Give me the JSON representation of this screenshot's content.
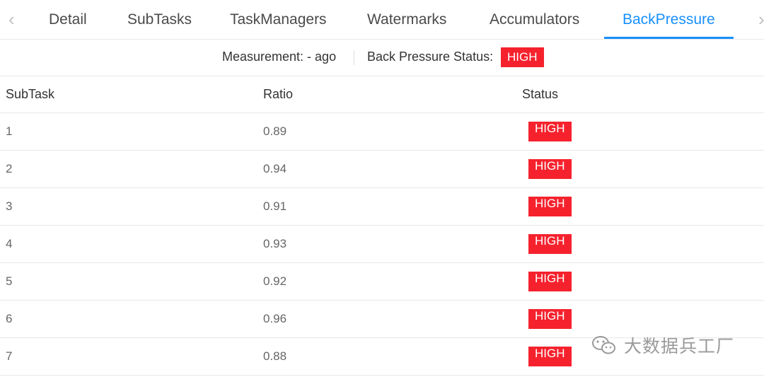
{
  "tabs": {
    "prev_arrow": "‹",
    "next_arrow": "›",
    "items": [
      {
        "label": "Detail"
      },
      {
        "label": "SubTasks"
      },
      {
        "label": "TaskManagers"
      },
      {
        "label": "Watermarks"
      },
      {
        "label": "Accumulators"
      },
      {
        "label": "BackPressure",
        "active": true
      }
    ]
  },
  "summary": {
    "measurement": "Measurement: - ago",
    "status_label": "Back Pressure Status:",
    "status": "HIGH"
  },
  "table": {
    "headers": {
      "subtask": "SubTask",
      "ratio": "Ratio",
      "status": "Status"
    },
    "rows": [
      {
        "subtask": "1",
        "ratio": "0.89",
        "status": "HIGH"
      },
      {
        "subtask": "2",
        "ratio": "0.94",
        "status": "HIGH"
      },
      {
        "subtask": "3",
        "ratio": "0.91",
        "status": "HIGH"
      },
      {
        "subtask": "4",
        "ratio": "0.93",
        "status": "HIGH"
      },
      {
        "subtask": "5",
        "ratio": "0.92",
        "status": "HIGH"
      },
      {
        "subtask": "6",
        "ratio": "0.96",
        "status": "HIGH"
      },
      {
        "subtask": "7",
        "ratio": "0.88",
        "status": "HIGH"
      }
    ]
  },
  "watermark": {
    "text": "大数据兵工厂",
    "icon": "wechat-icon"
  },
  "colors": {
    "accent": "#1890ff",
    "high": "#f5222d"
  }
}
